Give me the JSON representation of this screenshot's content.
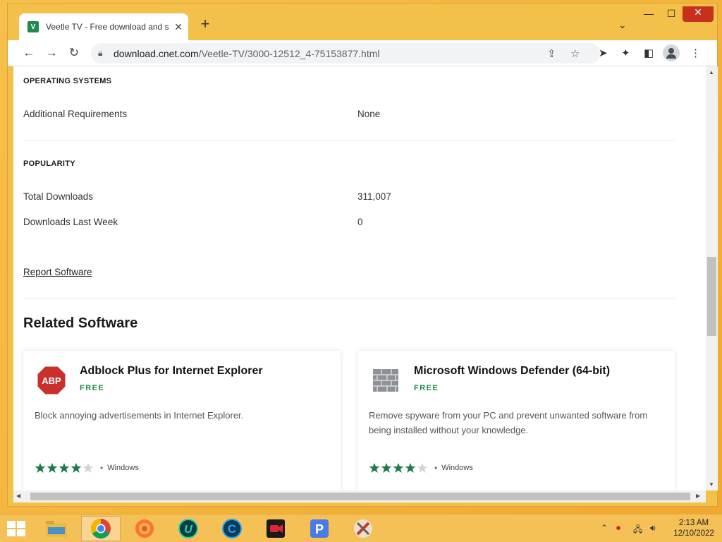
{
  "browser": {
    "tab_title": "Veetle TV - Free download and s",
    "tab_favicon_letter": "V",
    "url_host": "download.cnet.com",
    "url_path": "/Veetle-TV/3000-12512_4-75153877.html"
  },
  "page": {
    "os_section_title": "OPERATING SYSTEMS",
    "os_rows": [
      {
        "key": "Additional Requirements",
        "value": "None"
      }
    ],
    "popularity_title": "POPULARITY",
    "popularity_rows": [
      {
        "key": "Total Downloads",
        "value": "311,007"
      },
      {
        "key": "Downloads Last Week",
        "value": "0"
      }
    ],
    "report_link": "Report Software",
    "related_title": "Related Software",
    "related": [
      {
        "name": "Adblock Plus for Internet Explorer",
        "logo_text": "ABP",
        "price": "FREE",
        "description": "Block annoying advertisements in Internet Explorer.",
        "rating": 4,
        "rating_max": 5,
        "platform": "Windows"
      },
      {
        "name": "Microsoft Windows Defender (64-bit)",
        "price": "FREE",
        "description": "Remove spyware from your PC and prevent unwanted software from being installed without your knowledge.",
        "rating": 4,
        "rating_max": 5,
        "platform": "Windows"
      }
    ]
  },
  "taskbar": {
    "apps": [
      "file-explorer",
      "chrome",
      "firefox",
      "uplay",
      "ccleaner",
      "screen-recorder",
      "pdf-app",
      "settings-tool"
    ],
    "clock_time": "2:13 AM",
    "clock_date": "12/10/2022"
  },
  "colors": {
    "accent_green": "#1b8a4a",
    "star_green": "#1b7a4a",
    "window_frame": "#f3c14a"
  }
}
